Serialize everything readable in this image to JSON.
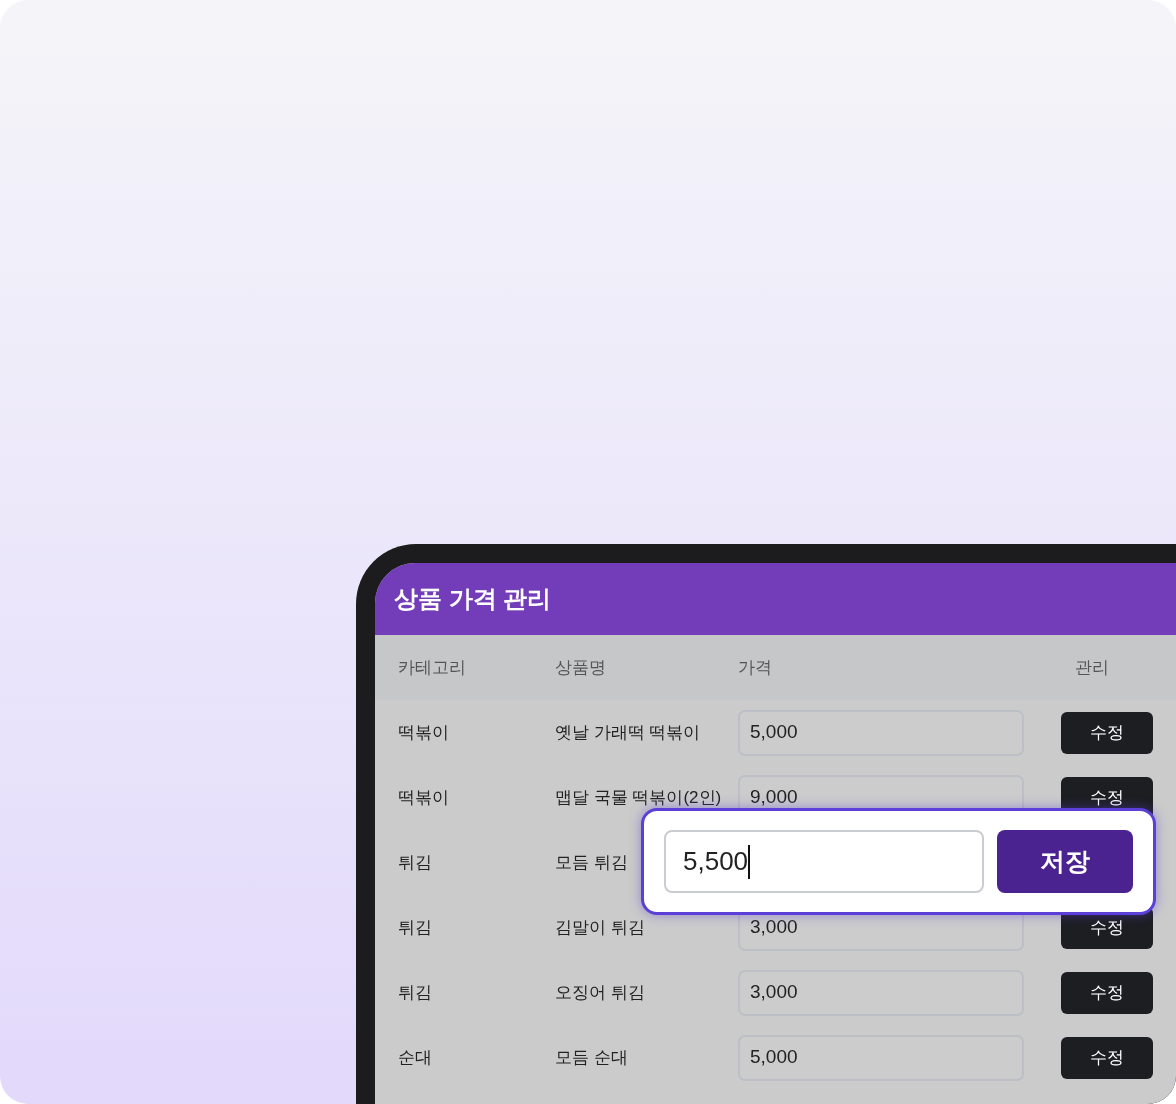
{
  "screen": {
    "title": "상품 가격 관리"
  },
  "table": {
    "columns": [
      "카테고리",
      "상품명",
      "가격",
      "관리"
    ],
    "rows": [
      {
        "category": "떡볶이",
        "name": "옛날 가래떡 떡볶이",
        "price": "5,000",
        "action": "수정"
      },
      {
        "category": "떡볶이",
        "name": "맵달 국물 떡볶이(2인)",
        "price": "9,000",
        "action": "수정"
      },
      {
        "category": "튀김",
        "name": "모듬 튀김"
      },
      {
        "category": "튀김",
        "name": "김말이 튀김",
        "price": "3,000",
        "action": "수정"
      },
      {
        "category": "튀김",
        "name": "오징어 튀김",
        "price": "3,000",
        "action": "수정"
      },
      {
        "category": "순대",
        "name": "모듬 순대",
        "price": "5,000",
        "action": "수정"
      }
    ]
  },
  "edit_popup": {
    "value": "5,500",
    "button": "저장"
  }
}
